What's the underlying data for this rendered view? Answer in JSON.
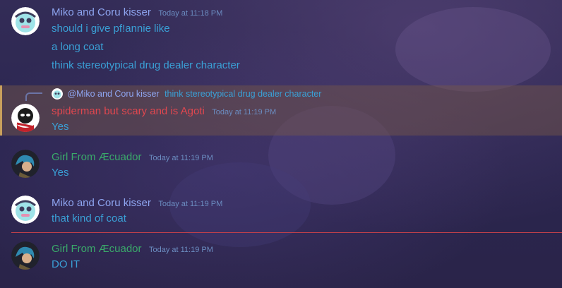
{
  "messages": [
    {
      "author": "Miko and Coru kisser",
      "timestamp": "Today at 11:18 PM",
      "lines": [
        "should i give pf!annie like",
        "a long coat",
        "think stereotypical drug dealer character"
      ]
    },
    {
      "author": "spiderman but scary and is Agoti",
      "timestamp": "Today at 11:19 PM",
      "reply": {
        "author": "@Miko and Coru kisser",
        "text": "think stereotypical drug dealer character"
      },
      "lines": [
        "Yes"
      ]
    },
    {
      "author": "Girl From Æcuador",
      "timestamp": "Today at 11:19 PM",
      "lines": [
        "Yes"
      ]
    },
    {
      "author": "Miko and Coru kisser",
      "timestamp": "Today at 11:19 PM",
      "lines": [
        "that kind of coat"
      ]
    },
    {
      "author": "Girl From Æcuador",
      "timestamp": "Today at 11:19 PM",
      "lines": [
        "DO IT"
      ]
    }
  ],
  "colors": {
    "miko": "#8ea5f0",
    "spider": "#e0474f",
    "girl": "#3aa96a",
    "message_text": "#3aa0d6",
    "timestamp": "#6b8cc0",
    "new_divider": "#c0404a",
    "highlight": "#c9a05c"
  },
  "icons": {
    "avatar_miko": "cartoon-pale-face-avatar",
    "avatar_spider": "red-black-spider-avatar",
    "avatar_girl": "dark-character-avatar"
  }
}
